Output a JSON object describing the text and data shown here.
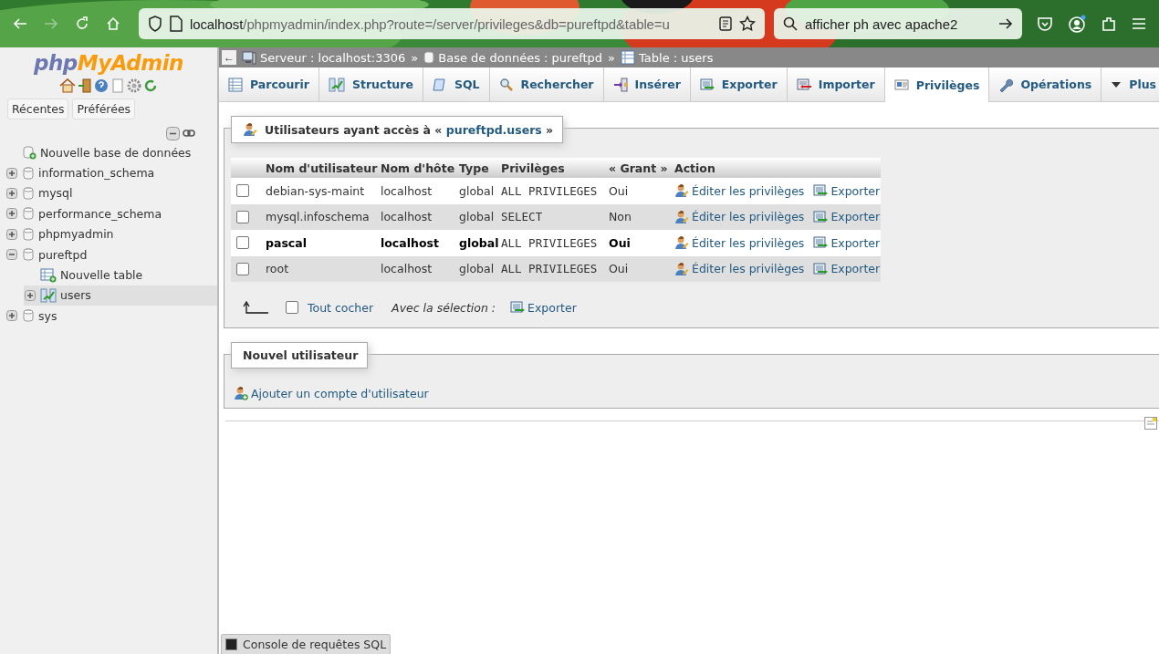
{
  "browser": {
    "url_host": "localhost",
    "url_path": "/phpmyadmin/index.php?route=/server/privileges&db=pureftpd&table=u",
    "search": "afficher ph avec apache2",
    "forward_disabled": true,
    "account_notification": true
  },
  "sidebar": {
    "logo_php": "php",
    "logo_myadmin": "MyAdmin",
    "buttons": [
      "Récentes",
      "Préférées"
    ],
    "tree": [
      {
        "label": "Nouvelle base de données",
        "kind": "new",
        "selected": false
      },
      {
        "label": "information_schema",
        "kind": "db",
        "expanded": false,
        "selected": false
      },
      {
        "label": "mysql",
        "kind": "db",
        "expanded": false,
        "selected": false
      },
      {
        "label": "performance_schema",
        "kind": "db",
        "expanded": false,
        "selected": false
      },
      {
        "label": "phpmyadmin",
        "kind": "db",
        "expanded": false,
        "selected": false
      },
      {
        "label": "pureftpd",
        "kind": "db",
        "expanded": true,
        "selected": false,
        "children": [
          {
            "label": "Nouvelle table",
            "kind": "newtable",
            "selected": false
          },
          {
            "label": "users",
            "kind": "table",
            "expanded": false,
            "selected": true
          }
        ]
      },
      {
        "label": "sys",
        "kind": "db",
        "expanded": false,
        "selected": false
      }
    ]
  },
  "breadcrumb": [
    {
      "label": "Serveur : localhost:3306",
      "kind": "server"
    },
    {
      "label": "Base de données : pureftpd",
      "kind": "db"
    },
    {
      "label": "Table : users",
      "kind": "table"
    }
  ],
  "breadcrumb_separator": "»",
  "back_arrow": "←",
  "tabs": [
    {
      "label": "Parcourir",
      "selected": false
    },
    {
      "label": "Structure",
      "selected": false
    },
    {
      "label": "SQL",
      "selected": false
    },
    {
      "label": "Rechercher",
      "selected": false
    },
    {
      "label": "Insérer",
      "selected": false
    },
    {
      "label": "Exporter",
      "selected": false
    },
    {
      "label": "Importer",
      "selected": false
    },
    {
      "label": "Privilèges",
      "selected": true
    },
    {
      "label": "Opérations",
      "selected": false
    },
    {
      "label": "Plus",
      "selected": false
    }
  ],
  "users_panel": {
    "title_prefix": "Utilisateurs ayant accès à «",
    "title_link": "pureftpd.users",
    "title_suffix": "»",
    "columns": [
      "Nom d'utilisateur",
      "Nom d'hôte",
      "Type",
      "Privilèges",
      "« Grant »",
      "Action"
    ],
    "rows": [
      {
        "checked": false,
        "current": false,
        "user": "debian-sys-maint",
        "host": "localhost",
        "type": "global",
        "privileges": "ALL PRIVILEGES",
        "grant": "Oui",
        "edit": "Éditer les privilèges",
        "export": "Exporter"
      },
      {
        "checked": false,
        "current": false,
        "user": "mysql.infoschema",
        "host": "localhost",
        "type": "global",
        "privileges": "SELECT",
        "grant": "Non",
        "edit": "Éditer les privilèges",
        "export": "Exporter"
      },
      {
        "checked": false,
        "current": true,
        "user": "pascal",
        "host": "localhost",
        "type": "global",
        "privileges": "ALL PRIVILEGES",
        "grant": "Oui",
        "edit": "Éditer les privilèges",
        "export": "Exporter"
      },
      {
        "checked": false,
        "current": false,
        "user": "root",
        "host": "localhost",
        "type": "global",
        "privileges": "ALL PRIVILEGES",
        "grant": "Oui",
        "edit": "Éditer les privilèges",
        "export": "Exporter"
      }
    ],
    "check_all": {
      "label": "Tout cocher",
      "checked": false
    },
    "with_selection": "Avec la sélection :",
    "export": "Exporter"
  },
  "new_user_panel": {
    "title": "Nouvel utilisateur",
    "link": "Ajouter un compte d'utilisateur"
  },
  "console": "Console de requêtes SQL"
}
